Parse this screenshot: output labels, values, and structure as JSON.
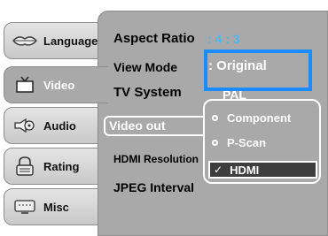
{
  "sidebar": {
    "items": [
      {
        "label": "Language",
        "icon": "lips-icon"
      },
      {
        "label": "Video",
        "icon": "tv-icon"
      },
      {
        "label": "Audio",
        "icon": "speaker-icon"
      },
      {
        "label": "Rating",
        "icon": "lock-icon"
      },
      {
        "label": "Misc",
        "icon": "screen-icon"
      }
    ]
  },
  "settings": {
    "aspect_ratio_label": "Aspect Ratio",
    "aspect_ratio_value": ": 4 : 3",
    "view_mode_label": "View Mode",
    "view_mode_value": ": Original",
    "tv_system_label": "TV System",
    "tv_system_value": "PAL",
    "video_out_label": "Video out",
    "hdmi_resolution_label": "HDMI Resolution",
    "jpeg_interval_label": "JPEG Interval"
  },
  "video_out_menu": {
    "options": [
      "Component",
      "P-Scan",
      "HDMI"
    ],
    "selected": "HDMI"
  },
  "colors": {
    "panel": "#a9a9a9",
    "value_text": "#4fb6ef",
    "highlight": "#1a8cff"
  }
}
